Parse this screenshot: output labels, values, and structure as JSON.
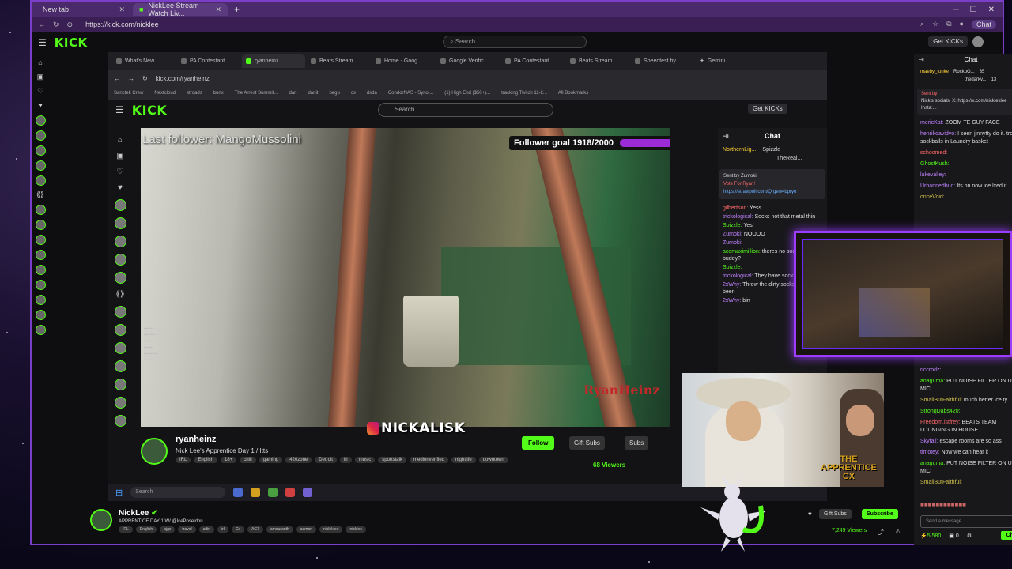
{
  "outer_browser": {
    "tabs": [
      {
        "label": "New tab",
        "active": false
      },
      {
        "label": "NickLee Stream - Watch Liv...",
        "active": true
      }
    ],
    "url": "https://kick.com/nicklee",
    "chat_pill": "Chat"
  },
  "outer_header": {
    "logo": "KICK",
    "search_placeholder": "Search",
    "get_kicks": "Get KICKs"
  },
  "inner_browser": {
    "tabs": [
      "What's New",
      "PA Contestant",
      "ryanheinz",
      "Beats Stream",
      "Home - Goog",
      "Google Verific",
      "PA Contestant",
      "Beats Stream",
      "Speedtest by",
      "Gemini"
    ],
    "url": "kick.com/ryanheinz",
    "bookmarks": [
      "Sanctek Crew",
      "Nextcloud",
      "stroads",
      "bunx",
      "The Arrest Summit...",
      "dan",
      "danit",
      "begu",
      "cs",
      "dsda",
      "CondorNAS - Synol...",
      "(1) High End ($50+)...",
      "tracking Twitch 11-2...",
      "All Bookmarks"
    ]
  },
  "inner_header": {
    "logo": "KICK",
    "search_placeholder": "Search",
    "get_kicks": "Get KICKs"
  },
  "inner_video": {
    "last_follower": "Last follower: MangoMussolini",
    "goal_text": "Follower goal 1918/2000",
    "goal_fraction": 0.959,
    "brand_text": "RyanHeinz"
  },
  "inner_chat": {
    "title": "Chat",
    "top": [
      "NorthernLig...",
      "Spizzle",
      "TheReal..."
    ],
    "pin": {
      "sender": "Sent by",
      "user": "Zumoki",
      "text": "Vote For Ryan!",
      "link": "https://strawpoll.com/Qrgew4bpryo"
    },
    "messages": [
      {
        "user": "gilbertson:",
        "text": "Yess",
        "color": "u-r"
      },
      {
        "user": "trickological:",
        "text": "Socks not that metal thin",
        "color": "u-p"
      },
      {
        "user": "Spizzle:",
        "text": "Yes!",
        "color": "u-gn"
      },
      {
        "user": "Zumoki:",
        "text": "NOOOO",
        "color": "u-p"
      },
      {
        "user": "Zumoki:",
        "text": "",
        "color": "u-p"
      },
      {
        "user": "acemaximillion:",
        "text": "theres no sock ground buddy?",
        "color": "u-gn"
      },
      {
        "user": "Spizzle:",
        "text": "",
        "color": "u-gn"
      },
      {
        "user": "trickological:",
        "text": "They have socks they ju lol",
        "color": "u-p"
      },
      {
        "user": "2xWhy:",
        "text": "Throw the dirty socks i laundry been",
        "color": "u-p"
      },
      {
        "user": "2xWhy:",
        "text": "bin",
        "color": "u-p"
      }
    ]
  },
  "inner_stream": {
    "name": "ryanheinz",
    "title": "Nick Lee's Apprentice Day 1 / Itts",
    "tags": [
      "IRL",
      "English",
      "18+",
      "chill",
      "gaming",
      "420zone",
      "Detroit",
      "irl",
      "music",
      "sportstalk",
      "medionverified",
      "nightlife",
      "downtown"
    ],
    "follow": "Follow",
    "gift_subs": "Gift Subs",
    "subs": "Subs",
    "viewers": "68 Viewers"
  },
  "taskbar": {
    "search_placeholder": "Search"
  },
  "overlay_handle": "NICKALISK",
  "webcam_overlay": {
    "line1": "THE",
    "line2": "APPRENTICE",
    "line3": "CX"
  },
  "outer_chat": {
    "title": "Chat",
    "top": [
      {
        "user": "maeby_funke",
        "value": "35"
      },
      {
        "user": "RockoG...",
        "value": ""
      },
      {
        "user": "thedarkv...",
        "value": "13"
      }
    ],
    "pin": {
      "sender": "Sent by",
      "text": "Nick's socials: X: https://x.com/nickleklee Insta:..."
    },
    "messages_top": [
      {
        "user": "mericKat:",
        "text": "ZOOM TE GUY FACE",
        "color": "u-p"
      },
      {
        "user": "henrikdavidvo:",
        "text": "I seen jinnytty do it. trow sockballs in Laundry basket",
        "color": "u-p"
      },
      {
        "user": "schoomed:",
        "text": "",
        "color": "u-r"
      },
      {
        "user": "GhostKush:",
        "text": "",
        "color": "u-gn"
      },
      {
        "user": "lakevalley:",
        "text": "",
        "color": "u-p"
      },
      {
        "user": "Urbannedbud:",
        "text": "Its on now ice lxed it",
        "color": "u-p"
      },
      {
        "user": "onceVoid:",
        "text": "",
        "color": "u-y"
      }
    ],
    "messages_bottom": [
      {
        "user": "riccrodz:",
        "text": "",
        "color": "u-p"
      },
      {
        "user": "anaguma:",
        "text": "PUT NOISE FILTER ON UR MIC",
        "color": "u-gn"
      },
      {
        "user": "SmallButFaithful:",
        "text": "much better ice ty",
        "color": "u-y"
      },
      {
        "user": "StrongDabs420:",
        "text": "",
        "color": "u-gn"
      },
      {
        "user": "Freedom.istfrey:",
        "text": "BEATS TEAM LOUNGING IN HOUSE",
        "color": "u-r"
      },
      {
        "user": "Skyfall:",
        "text": "escape rooms are so ass",
        "color": "u-p"
      },
      {
        "user": "timotey:",
        "text": "Now we can hear it",
        "color": "u-p"
      },
      {
        "user": "anaguma:",
        "text": "PUT NOISE FILTER ON UR MIC",
        "color": "u-gn"
      },
      {
        "user": "SmallButFaithful:",
        "text": "",
        "color": "u-y"
      }
    ],
    "input_placeholder": "Send a message",
    "kicks_count": "5,580",
    "zero": "0",
    "chat_button": "Chat"
  },
  "outer_stream": {
    "name": "NickLee",
    "title": "APPRENTICE DAY 1 W/ @IcePoseidon",
    "tags": [
      "IRL",
      "English",
      "ajgc",
      "travel",
      "adin",
      "irl",
      "Cx",
      "AC7",
      "amouranth",
      "aamon",
      "nicleklee",
      "nicklee"
    ],
    "gift_subs": "Gift Subs",
    "subscribe": "Subscribe",
    "viewers": "7,249 Viewers"
  }
}
